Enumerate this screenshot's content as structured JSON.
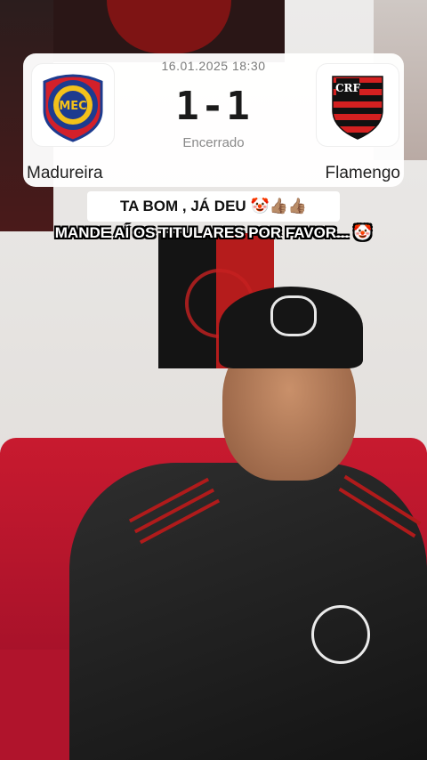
{
  "match": {
    "datetime": "16.01.2025 18:30",
    "score": "1-1",
    "status": "Encerrado",
    "home_team": "Madureira",
    "away_team": "Flamengo"
  },
  "captions": {
    "line1": "TA BOM , JÁ DEU",
    "line1_emoji": "🤡👍🏽👍🏽",
    "line2": "MANDE AÍ OS TITULARES POR FAVOR...",
    "line2_emoji": "🤡"
  },
  "colors": {
    "flamengo_red": "#d42020",
    "flamengo_black": "#111111",
    "madureira_blue": "#1d3b8f",
    "madureira_yellow": "#f3c11a",
    "madureira_red": "#d3202a"
  }
}
